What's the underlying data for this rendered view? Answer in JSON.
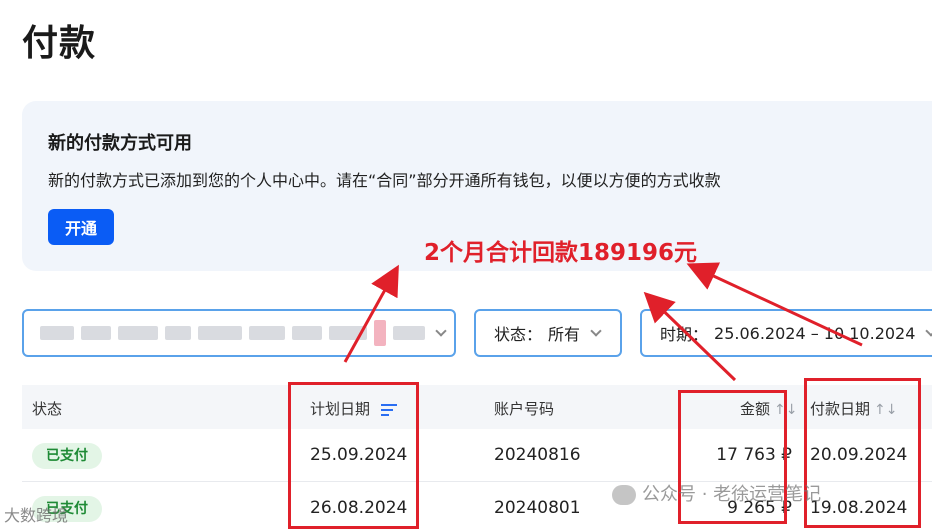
{
  "page": {
    "title": "付款"
  },
  "banner": {
    "title": "新的付款方式可用",
    "text": "新的付款方式已添加到您的个人中心中。请在“合同”部分开通所有钱包，以便以方便的方式收款",
    "button_label": "开通"
  },
  "filters": {
    "status_label": "状态：",
    "status_value": "所有",
    "period_label": "时期：",
    "period_value": "25.06.2024 – 10.10.2024"
  },
  "table": {
    "headers": {
      "status": "状态",
      "planned_date": "计划日期",
      "account_number": "账户号码",
      "amount": "金额",
      "payment_date": "付款日期"
    },
    "rows": [
      {
        "status": "已支付",
        "planned_date": "25.09.2024",
        "account_number": "20240816",
        "amount": "17 763 ₽",
        "payment_date": "20.09.2024"
      },
      {
        "status": "已支付",
        "planned_date": "26.08.2024",
        "account_number": "20240801",
        "amount": "9 265 ₽",
        "payment_date": "19.08.2024"
      }
    ]
  },
  "annotation": {
    "text": "2个月合计回款189196元",
    "color": "#e0202a"
  },
  "watermarks": {
    "left": "大数跨境",
    "right": "公众号 · 老徐运营笔记"
  },
  "colors": {
    "primary": "#0a5cf5",
    "badge_bg": "#e3f5e6",
    "badge_text": "#1e8a35",
    "filter_border": "#5aa2ea"
  }
}
